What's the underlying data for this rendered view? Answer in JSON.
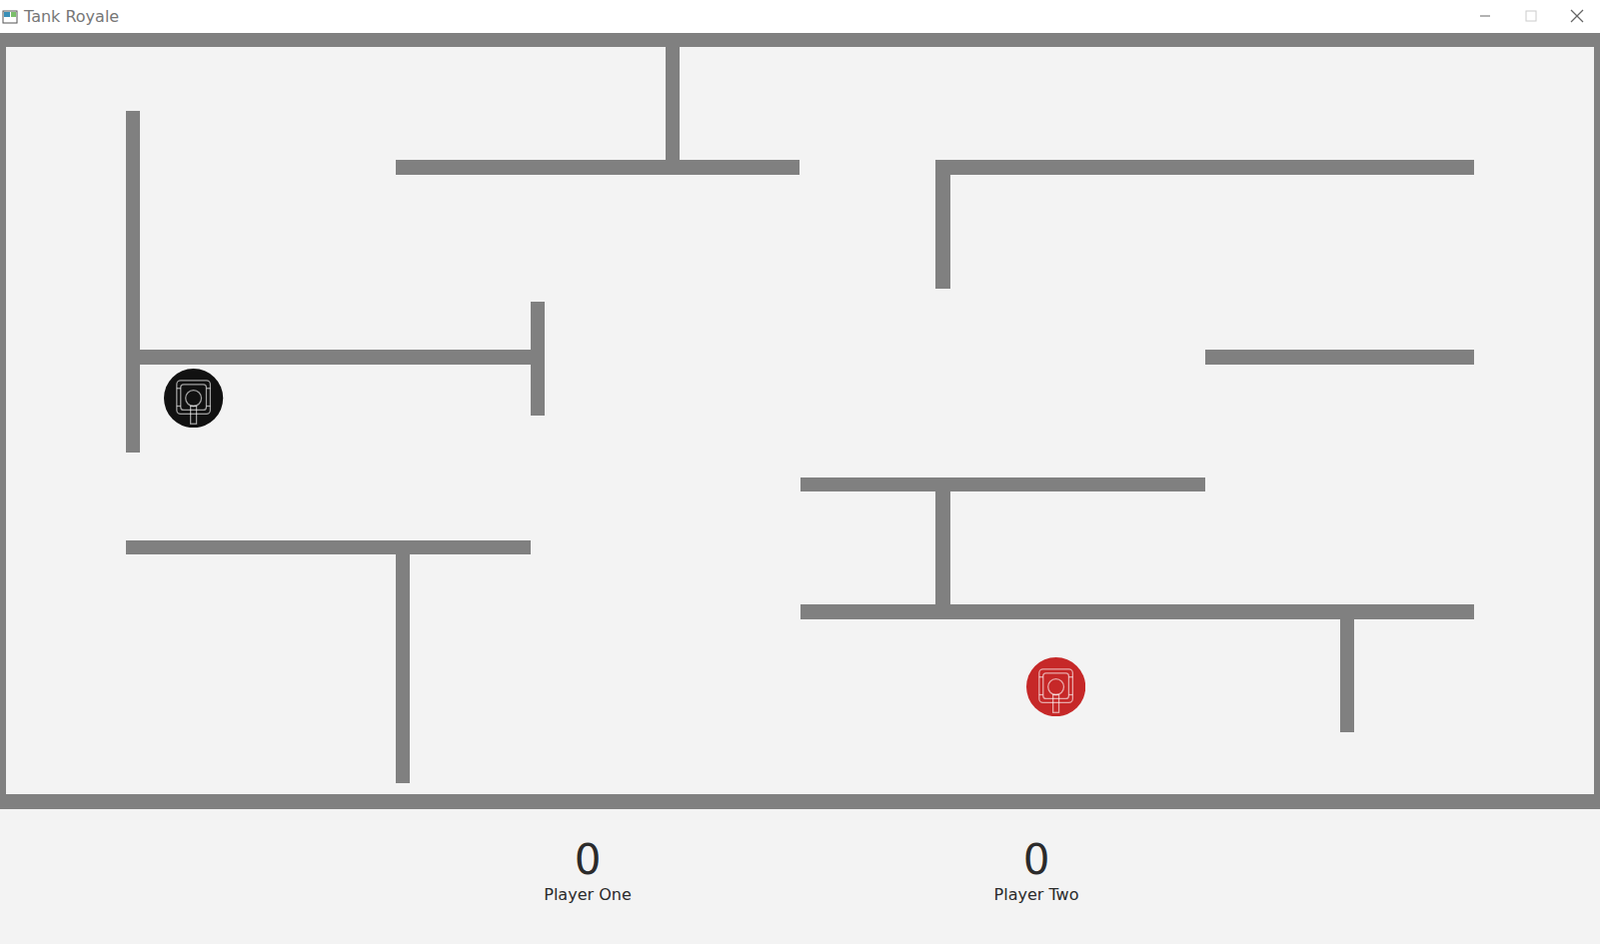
{
  "window": {
    "title": "Tank Royale"
  },
  "tanks": [
    {
      "color": "#111111"
    },
    {
      "color": "#c62828"
    }
  ],
  "scores": [
    {
      "score": "0",
      "label": "Player One"
    },
    {
      "score": "0",
      "label": "Player Two"
    }
  ]
}
